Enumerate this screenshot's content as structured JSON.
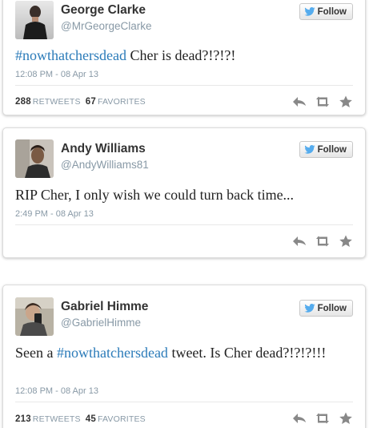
{
  "colors": {
    "hashtag": "#2b7bb9",
    "meta": "#8899a6",
    "text": "#222222",
    "icon": "#888888",
    "follow_bird": "#55acee"
  },
  "tweets": [
    {
      "name": "George Clarke",
      "handle": "@MrGeorgeClarke",
      "follow_label": "Follow",
      "text_parts": [
        {
          "type": "hashtag",
          "text": "#nowthatchersdead"
        },
        {
          "type": "text",
          "text": " Cher is dead?!?!?!"
        }
      ],
      "time": "12:08 PM - 08 Apr 13",
      "retweets": "288",
      "retweets_label": "RETWEETS",
      "favorites": "67",
      "favorites_label": "FAVORITES"
    },
    {
      "name": "Andy Williams",
      "handle": "@AndyWilliams81",
      "follow_label": "Follow",
      "text_parts": [
        {
          "type": "text",
          "text": "RIP Cher, I only wish we could turn back time..."
        }
      ],
      "time": "2:49 PM - 08 Apr 13"
    },
    {
      "name": "Gabriel Himme",
      "handle": "@GabrielHimme",
      "follow_label": "Follow",
      "text_parts": [
        {
          "type": "text",
          "text": "Seen a "
        },
        {
          "type": "hashtag",
          "text": "#nowthatchersdead"
        },
        {
          "type": "text",
          "text": " tweet. Is Cher dead?!?!?!!!"
        }
      ],
      "time": "12:08 PM - 08 Apr 13",
      "retweets": "213",
      "retweets_label": "RETWEETS",
      "favorites": "45",
      "favorites_label": "FAVORITES"
    }
  ],
  "icons": {
    "reply": "reply-icon",
    "retweet": "retweet-icon",
    "favorite": "star-icon",
    "follow": "twitter-bird-icon"
  }
}
